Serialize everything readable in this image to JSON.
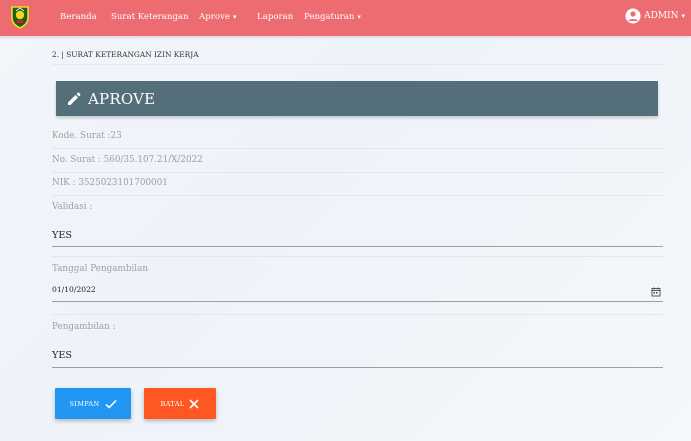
{
  "navbar": {
    "items": [
      {
        "label": "Beranda",
        "dropdown": false
      },
      {
        "label": "Surat Keterangan",
        "dropdown": false
      },
      {
        "label": "Aprove",
        "dropdown": true
      },
      {
        "label": "Laporan",
        "dropdown": false
      },
      {
        "label": "Pengaturan",
        "dropdown": true
      }
    ],
    "user": "ADMIN",
    "user_icon": "user-circle-icon",
    "colors": {
      "bar": "#ed6c72",
      "text": "#ffffff"
    }
  },
  "breadcrumb": "2. | SURAT KETERANGAN IZIN KERJA",
  "header": {
    "title": "APROVE",
    "icon": "pencil-icon",
    "color": "#546e7a"
  },
  "info": {
    "kode_surat": "Kode. Surat :23",
    "no_surat": "No. Surat : 560/35.107.21/X/2022",
    "nik": "NIK : 3525023101700001"
  },
  "validasi": {
    "label": "Validasi :",
    "value": "YES"
  },
  "tanggal": {
    "label": "Tanggal Pengambilan",
    "value": "01/10/2022",
    "icon": "calendar-icon"
  },
  "pengambilan": {
    "label": "Pengambilan :",
    "value": "YES"
  },
  "buttons": {
    "save": {
      "label": "SIMPAN",
      "icon": "check-icon",
      "color": "#2196f3"
    },
    "cancel": {
      "label": "BATAL",
      "icon": "close-icon",
      "color": "#ff5722"
    }
  }
}
